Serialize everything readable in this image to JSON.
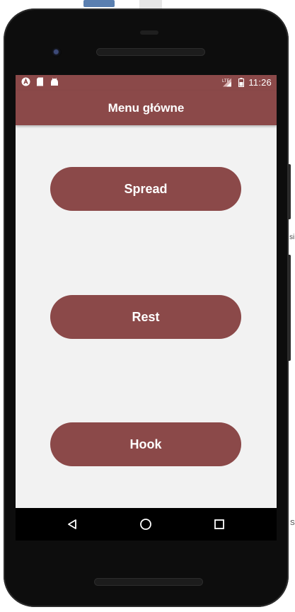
{
  "status_bar": {
    "time": "11:26",
    "network": "LTE",
    "icons_left": [
      "app-a-icon",
      "sd-card-icon",
      "android-icon"
    ],
    "icons_right": [
      "signal-icon",
      "battery-icon"
    ]
  },
  "app_bar": {
    "title": "Menu główne"
  },
  "menu": {
    "buttons": [
      {
        "label": "Spread"
      },
      {
        "label": "Rest"
      },
      {
        "label": "Hook"
      }
    ]
  },
  "nav_bar": {
    "icons": [
      "back-icon",
      "home-icon",
      "recents-icon"
    ]
  },
  "colors": {
    "primary": "#8b4949",
    "background": "#f2f2f2",
    "text_on_primary": "#ffffff"
  },
  "outside": {
    "side_text_1": "si",
    "side_text_2": "S"
  }
}
